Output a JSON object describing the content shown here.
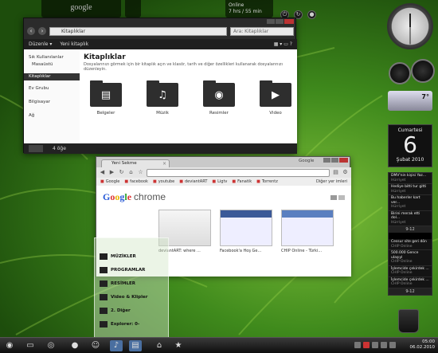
{
  "top_bar": {
    "google_search": "google",
    "online_status": "Online",
    "online_time": "7 hrs / 55 min"
  },
  "explorer": {
    "breadcrumb": "Kitaplıklar",
    "search_placeholder": "Ara: Kitaplıklar",
    "toolbar": {
      "organize": "Düzenle ▾",
      "new_library": "Yeni kitaplık"
    },
    "sidebar": [
      {
        "label": "Sık Kullanılanlar",
        "selected": false
      },
      {
        "label": "Masaüstü",
        "selected": false
      },
      {
        "label": "Kitaplıklar",
        "selected": true
      },
      {
        "label": "Ev Grubu",
        "selected": false
      },
      {
        "label": "Bilgisayar",
        "selected": false
      },
      {
        "label": "Ağ",
        "selected": false
      }
    ],
    "title": "Kitaplıklar",
    "description": "Dosyalarınızı görmek için bir kitaplık açın ve klasör, tarih ve diğer özellikleri kullanarak dosyalarınızı düzenleyin.",
    "folders": [
      {
        "label": "Belgeler",
        "icon": "document-icon",
        "glyph": "▤"
      },
      {
        "label": "Müzik",
        "icon": "music-icon",
        "glyph": "♫"
      },
      {
        "label": "Resimler",
        "icon": "camera-icon",
        "glyph": "◉"
      },
      {
        "label": "Video",
        "icon": "clapper-icon",
        "glyph": "▶"
      }
    ],
    "status": "4 öğe"
  },
  "chrome": {
    "tab_title": "Yeni Sekme",
    "window_title": "Google",
    "bookmarks": [
      "Google",
      "facebook",
      "youtube",
      "deviantART",
      "Ligtv",
      "Fanatik",
      "Torrentz"
    ],
    "other_bookmarks": "Diğer yer imleri",
    "logo": [
      "G",
      "o",
      "o",
      "g",
      "l",
      "e"
    ],
    "logo_suffix": "chrome",
    "thumbnails": [
      {
        "label": "deviantART: where ..."
      },
      {
        "label": "Facebook'a Hoş Ge..."
      },
      {
        "label": "CHIP Online - Türki..."
      }
    ]
  },
  "start_menu": {
    "items": [
      "MÜZİKLER",
      "PROGRAMLAR",
      "RESİMLER",
      "Video & Klipler",
      "2. Diğer",
      "Explorer: 0-"
    ]
  },
  "gadgets": {
    "weather_temp": "7°",
    "calendar_day": "Cumartesi",
    "calendar_date": "6",
    "calendar_month_year": "Şubat 2010",
    "feeds": [
      {
        "title": "DMV'nin kişisi Yaz...",
        "source": "Hürriyet"
      },
      {
        "title": "Hediye bitti tur gitti",
        "source": "Hürriyet"
      },
      {
        "title": "Bu haberler kart ver...",
        "source": "Hürriyet"
      },
      {
        "title": "Birini merak etti dol...",
        "source": "Hürriyet"
      }
    ],
    "feeds_pager": "9-12",
    "feeds2": [
      {
        "title": "Cessur site geri dön",
        "source": "CHIP Online"
      },
      {
        "title": "500.000 Gence ulaşıyl",
        "source": "CHIP Online"
      },
      {
        "title": "İşlemcide çekirdek ...",
        "source": "CHIP Online"
      },
      {
        "title": "İşlemcide çekirdek ...",
        "source": "CHIP Online"
      }
    ],
    "feeds2_pager": "9-12"
  },
  "taskbar": {
    "time": "05:00",
    "date": "06.02.2010"
  }
}
